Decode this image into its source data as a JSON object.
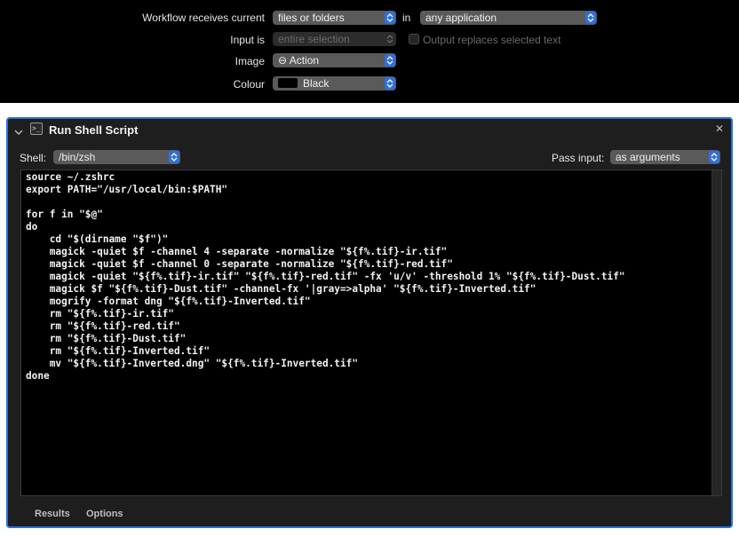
{
  "workflow": {
    "receives_label": "Workflow receives current",
    "receives_value": "files or folders",
    "in_label": "in",
    "app_value": "any application",
    "input_is_label": "Input is",
    "input_is_value": "entire selection",
    "output_replaces_label": "Output replaces selected text",
    "image_label": "Image",
    "image_value": "⊖ Action",
    "colour_label": "Colour",
    "colour_value": "Black",
    "colour_swatch": "#000000"
  },
  "action": {
    "title": "Run Shell Script",
    "shell_label": "Shell:",
    "shell_value": "/bin/zsh",
    "pass_input_label": "Pass input:",
    "pass_input_value": "as arguments",
    "accent_color": "#2a6fdb",
    "script_lines": [
      "source ~/.zshrc",
      "export PATH=\"/usr/local/bin:$PATH\"",
      "",
      "for f in \"$@\"",
      "do",
      "    cd \"$(dirname \"$f\")\"",
      "    magick -quiet $f -channel 4 -separate -normalize \"${f%.tif}-ir.tif\"",
      "    magick -quiet $f -channel 0 -separate -normalize \"${f%.tif}-red.tif\"",
      "    magick -quiet \"${f%.tif}-ir.tif\" \"${f%.tif}-red.tif\" -fx 'u/v' -threshold 1% \"${f%.tif}-Dust.tif\"",
      "    magick $f \"${f%.tif}-Dust.tif\" -channel-fx '|gray=>alpha' \"${f%.tif}-Inverted.tif\"",
      "    mogrify -format dng \"${f%.tif}-Inverted.tif\"",
      "    rm \"${f%.tif}-ir.tif\"",
      "    rm \"${f%.tif}-red.tif\"",
      "    rm \"${f%.tif}-Dust.tif\"",
      "    rm \"${f%.tif}-Inverted.tif\"",
      "    mv \"${f%.tif}-Inverted.dng\" \"${f%.tif}-Inverted.tif\"",
      "done"
    ],
    "tabs": [
      "Results",
      "Options"
    ]
  }
}
